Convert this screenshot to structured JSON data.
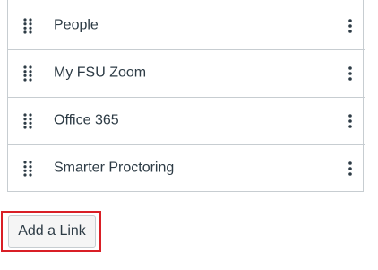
{
  "nav_items": [
    {
      "label": "People",
      "drag_icon": "drag-handle-icon",
      "menu_icon": "kebab-menu-icon"
    },
    {
      "label": "My FSU Zoom",
      "drag_icon": "drag-handle-icon",
      "menu_icon": "kebab-menu-icon"
    },
    {
      "label": "Office 365",
      "drag_icon": "drag-handle-icon",
      "menu_icon": "kebab-menu-icon"
    },
    {
      "label": "Smarter Proctoring",
      "drag_icon": "drag-handle-icon",
      "menu_icon": "kebab-menu-icon"
    }
  ],
  "add_link": {
    "label": "Add a Link",
    "highlight_color": "#d91f26"
  },
  "colors": {
    "text": "#2d3b45",
    "border": "#c7cdd1",
    "button_bg": "#f5f5f5",
    "highlight": "#d91f26"
  }
}
